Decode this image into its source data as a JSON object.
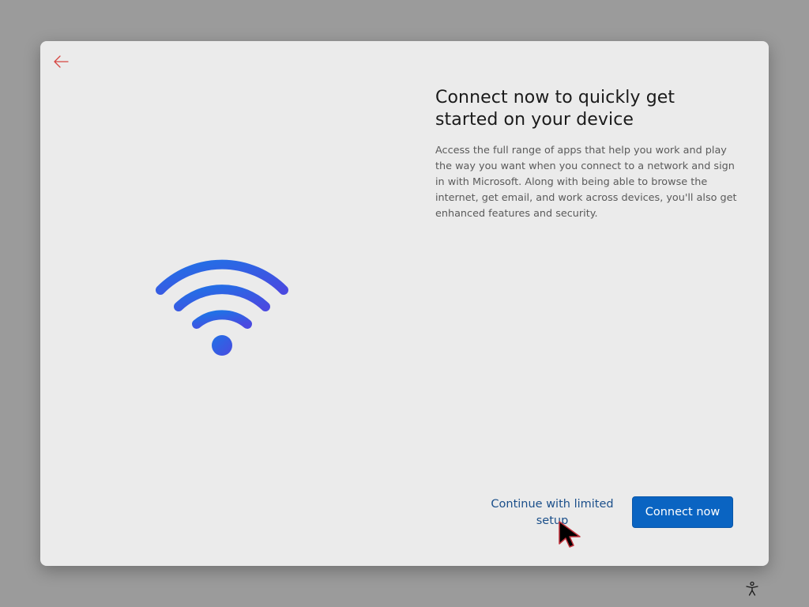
{
  "dialog": {
    "back_icon": "back-arrow-icon",
    "illustration_icon": "wifi-icon",
    "title": "Connect now to quickly get started on your device",
    "description": "Access the full range of apps that help you work and play the way you want when you connect to a network and sign in with Microsoft. Along with being able to browse the internet, get email, and work across devices, you'll also get enhanced features and security.",
    "secondary_button_label": "Continue with limited setup",
    "primary_button_label": "Connect now"
  },
  "footer": {
    "accessibility_icon": "accessibility-icon"
  },
  "colors": {
    "accent": "#0a64c2",
    "link": "#1b4f8a",
    "back_arrow": "#d64541",
    "wifi_gradient_start": "#1f6fe0",
    "wifi_gradient_end": "#4b4be0"
  }
}
